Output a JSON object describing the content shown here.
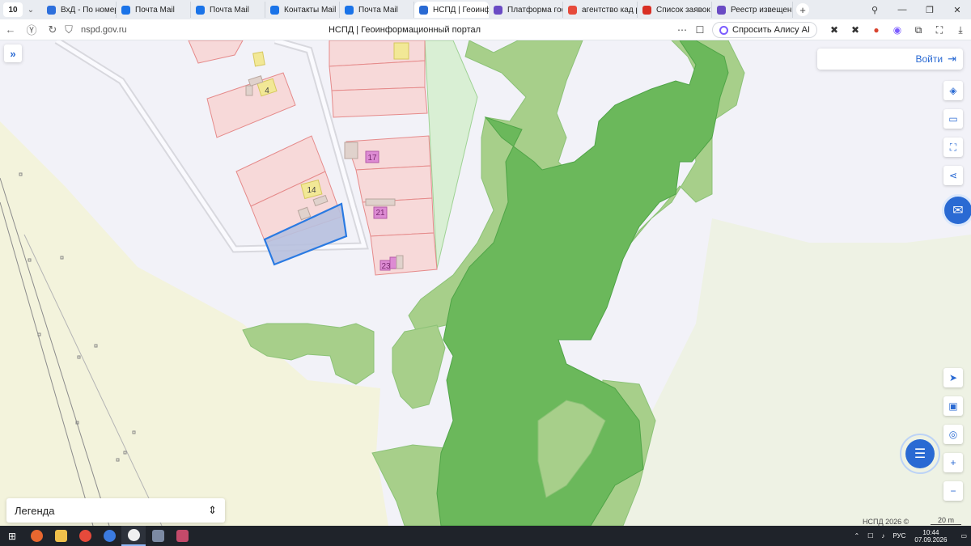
{
  "browser": {
    "tab_count": "10",
    "tabs": [
      {
        "label": "ВхД - По номеру",
        "icon": "vk-icon",
        "color": "#2d6fdc"
      },
      {
        "label": "Почта Mail",
        "icon": "mail-icon",
        "color": "#1a73e8"
      },
      {
        "label": "Почта Mail",
        "icon": "mail-icon",
        "color": "#1a73e8"
      },
      {
        "label": "Контакты Mail",
        "icon": "contacts-icon",
        "color": "#1a73e8"
      },
      {
        "label": "Почта Mail",
        "icon": "mail-icon",
        "color": "#1a73e8"
      },
      {
        "label": "НСПД | Геоинф",
        "icon": "nspd-icon",
        "color": "#2a6ad3",
        "active": true
      },
      {
        "label": "Платформа госуд",
        "icon": "gov-icon",
        "color": "#6a4bc4"
      },
      {
        "label": "агентство кад раб",
        "icon": "yandex-icon",
        "color": "#e64a3b"
      },
      {
        "label": "Список заявок —",
        "icon": "gmail-icon",
        "color": "#d93025"
      },
      {
        "label": "Реестр извещени",
        "icon": "gov-icon",
        "color": "#6a4bc4"
      }
    ],
    "url": "nspd.gov.ru",
    "page_title": "НСПД | Геоинформационный портал",
    "alice_label": "Спросить Алису AI"
  },
  "map": {
    "parcel_numbers": [
      "4",
      "14",
      "17",
      "21",
      "23"
    ],
    "login_label": "Войти",
    "legend_label": "Легенда",
    "copyright": "НСПД 2026 ©",
    "scale_label": "20 m"
  },
  "taskbar": {
    "lang": "РУС",
    "time": "10:44",
    "date": "07.09.2026"
  },
  "colors": {
    "forest_dark": "#6bb85b",
    "forest_light": "#a7cf8a",
    "parcel_fill": "#f7d9d9",
    "parcel_stroke": "#e58a8a",
    "selection": "#2a7ae2",
    "accent": "#2a6ad3"
  }
}
